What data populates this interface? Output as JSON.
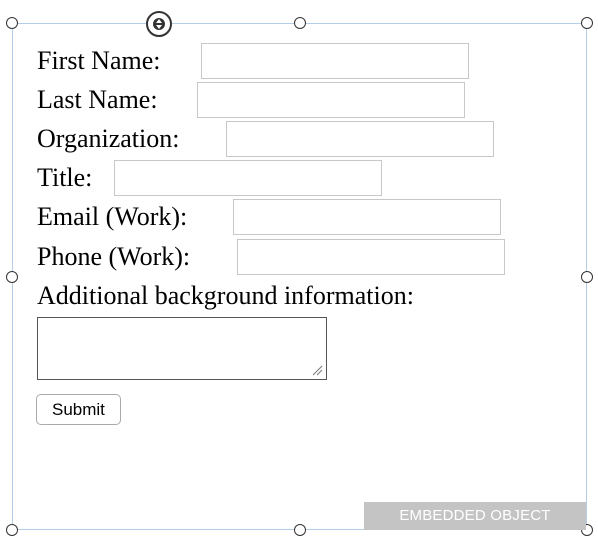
{
  "form": {
    "fields": [
      {
        "id": "first_name",
        "label": "First Name:",
        "value": ""
      },
      {
        "id": "last_name",
        "label": "Last Name:",
        "value": ""
      },
      {
        "id": "organization",
        "label": "Organization:",
        "value": ""
      },
      {
        "id": "title",
        "label": "Title:",
        "value": ""
      },
      {
        "id": "email_work",
        "label": "Email (Work):",
        "value": ""
      },
      {
        "id": "phone_work",
        "label": "Phone (Work):",
        "value": ""
      }
    ],
    "additional_label": "Additional background information:",
    "additional_value": "",
    "submit_label": "Submit"
  },
  "embedded_object": {
    "badge_label": "EMBEDDED OBJECT"
  },
  "colors": {
    "frame_border": "#b5cde6",
    "handle_stroke": "#333333",
    "badge_background": "#c4c4c4",
    "badge_text": "#ffffff"
  },
  "icons": {
    "move_handle": "move-arrows-icon",
    "resize_handles": "resize-handle-icon",
    "textarea_resize": "resize-grip-icon"
  }
}
